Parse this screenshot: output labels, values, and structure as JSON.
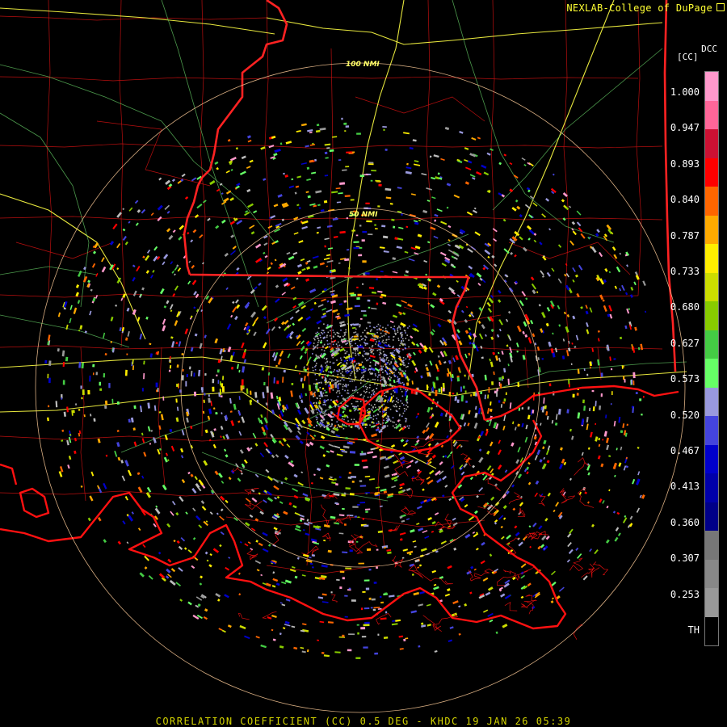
{
  "credit_text": "NEXLAB-College of DuPage",
  "footer_text": "CORRELATION COEFFICIENT (CC) 0.5 DEG - KHDC 19 JAN 26 05:39",
  "legend": {
    "product": "DCC",
    "unit": "[CC]",
    "labels": [
      "1.000",
      "0.947",
      "0.893",
      "0.840",
      "0.787",
      "0.733",
      "0.680",
      "0.627",
      "0.573",
      "0.520",
      "0.467",
      "0.413",
      "0.360",
      "0.307",
      "0.253",
      "TH"
    ],
    "colors": [
      "#ff99cc",
      "#ff6699",
      "#cc1133",
      "#ff0000",
      "#ff6600",
      "#ffaa00",
      "#ffee00",
      "#ccdd00",
      "#88cc00",
      "#44cc44",
      "#66ff66",
      "#9999dd",
      "#4444dd",
      "#0000cc",
      "#0000aa",
      "#000088",
      "#777777",
      "#888888",
      "#999999",
      "#000000"
    ]
  },
  "range_rings": [
    {
      "label": "50 NMI"
    },
    {
      "label": "100 NMI"
    }
  ],
  "map_colors": {
    "state_border": "#ff2222",
    "coastline": "#ff1111",
    "county": "#cc1111",
    "highway_interstate": "#ffff44",
    "highway_other": "#66cc66",
    "ring": "#ffcc99"
  }
}
